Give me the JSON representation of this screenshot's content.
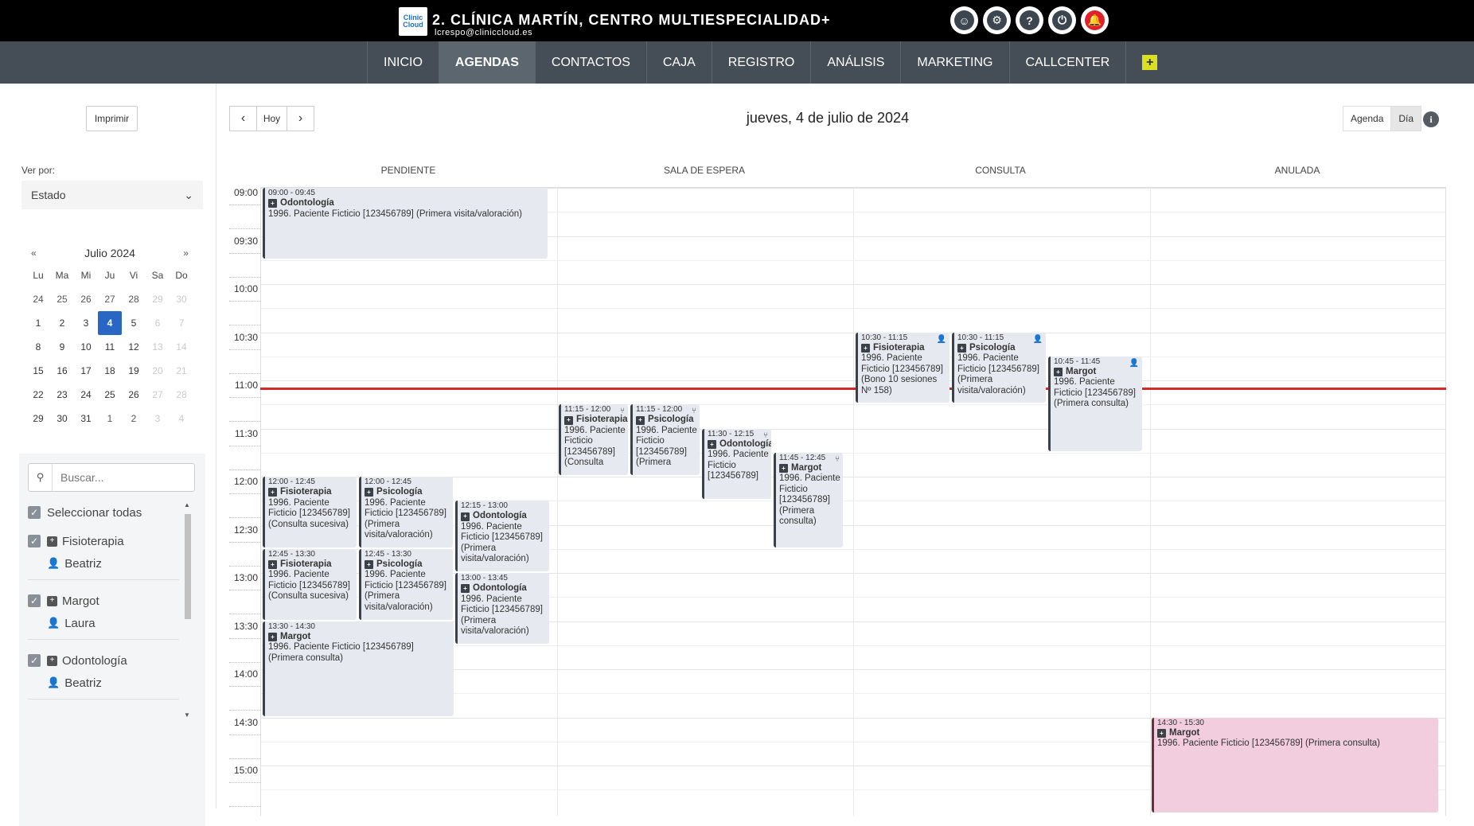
{
  "header": {
    "logo_text": "Clinic Cloud",
    "clinic_name": "2. CLÍNICA MARTÍN, CENTRO MULTIESPECIALIDAD+",
    "user_email": "lcrespo@cliniccloud.es",
    "icons": [
      "support-icon",
      "gear-icon",
      "help-icon",
      "power-icon",
      "bell-alert-icon"
    ]
  },
  "nav": {
    "items": [
      "INICIO",
      "AGENDAS",
      "CONTACTOS",
      "CAJA",
      "REGISTRO",
      "ANÁLISIS",
      "MARKETING",
      "CALLCENTER"
    ],
    "active": "AGENDAS",
    "add_label": "+"
  },
  "sidebar": {
    "print_label": "Imprimir",
    "ver_por_label": "Ver por:",
    "ver_por_value": "Estado",
    "calendar": {
      "prev": "«",
      "next": "»",
      "month": "Julio 2024",
      "weekdays": [
        "Lu",
        "Ma",
        "Mi",
        "Ju",
        "Vi",
        "Sa",
        "Do"
      ],
      "weeks": [
        [
          "24",
          "25",
          "26",
          "27",
          "28",
          "29",
          "30"
        ],
        [
          "1",
          "2",
          "3",
          "4",
          "5",
          "6",
          "7"
        ],
        [
          "8",
          "9",
          "10",
          "11",
          "12",
          "13",
          "14"
        ],
        [
          "15",
          "16",
          "17",
          "18",
          "19",
          "20",
          "21"
        ],
        [
          "22",
          "23",
          "24",
          "25",
          "26",
          "27",
          "28"
        ],
        [
          "29",
          "30",
          "31",
          "1",
          "2",
          "3",
          "4"
        ]
      ],
      "selected": "4"
    },
    "search_placeholder": "Buscar...",
    "select_all": "Seleccionar todas",
    "groups": [
      {
        "service": "Fisioterapia",
        "person": "Beatriz"
      },
      {
        "service": "Margot",
        "person": "Laura"
      },
      {
        "service": "Odontología",
        "person": "Beatriz"
      }
    ]
  },
  "toolbar": {
    "prev": "‹",
    "today": "Hoy",
    "next": "›",
    "date_title": "jueves, 4 de julio de 2024",
    "view_agenda": "Agenda",
    "view_day": "Día",
    "info": "i"
  },
  "columns": [
    "PENDIENTE",
    "SALA DE ESPERA",
    "CONSULTA",
    "ANULADA"
  ],
  "times": [
    "09:00",
    "09:30",
    "10:00",
    "10:30",
    "11:00",
    "11:30",
    "12:00",
    "12:30",
    "13:00",
    "13:30",
    "14:00",
    "14:30",
    "15:00"
  ],
  "events": [
    {
      "time": "09:00 - 09:45",
      "service": "Odontología",
      "patient": "1996. Paciente Ficticio [123456789] (Primera visita/valoración)",
      "status": "PENDIENTE"
    },
    {
      "time": "12:00 - 12:45",
      "service": "Fisioterapia",
      "patient": "1996. Paciente Ficticio [123456789] (Consulta sucesiva)",
      "status": "PENDIENTE"
    },
    {
      "time": "12:00 - 12:45",
      "service": "Psicología",
      "patient": "1996. Paciente Ficticio [123456789] (Primera visita/valoración)",
      "status": "PENDIENTE"
    },
    {
      "time": "12:15 - 13:00",
      "service": "Odontología",
      "patient": "1996. Paciente Ficticio [123456789] (Primera visita/valoración)",
      "status": "PENDIENTE"
    },
    {
      "time": "12:45 - 13:30",
      "service": "Fisioterapia",
      "patient": "1996. Paciente Ficticio [123456789] (Consulta sucesiva)",
      "status": "PENDIENTE"
    },
    {
      "time": "12:45 - 13:30",
      "service": "Psicología",
      "patient": "1996. Paciente Ficticio [123456789] (Primera visita/valoración)",
      "status": "PENDIENTE"
    },
    {
      "time": "13:00 - 13:45",
      "service": "Odontología",
      "patient": "1996. Paciente Ficticio [123456789] (Primera visita/valoración)",
      "status": "PENDIENTE"
    },
    {
      "time": "13:30 - 14:30",
      "service": "Margot",
      "patient": "1996. Paciente Ficticio [123456789] (Primera consulta)",
      "status": "PENDIENTE"
    },
    {
      "time": "11:15 - 12:00",
      "service": "Fisioterapia",
      "patient": "1996. Paciente Ficticio [123456789] (Consulta",
      "status": "SALA DE ESPERA"
    },
    {
      "time": "11:15 - 12:00",
      "service": "Psicología",
      "patient": "1996. Paciente Ficticio [123456789] (Primera",
      "status": "SALA DE ESPERA"
    },
    {
      "time": "11:30 - 12:15",
      "service": "Odontología",
      "patient": "1996. Paciente Ficticio [123456789]",
      "status": "SALA DE ESPERA"
    },
    {
      "time": "11:45 - 12:45",
      "service": "Margot",
      "patient": "1996. Paciente Ficticio [123456789] (Primera consulta)",
      "status": "SALA DE ESPERA"
    },
    {
      "time": "10:30 - 11:15",
      "service": "Fisioterapia",
      "patient": "1996. Paciente Ficticio [123456789] (Bono 10 sesiones Nº 158)",
      "status": "CONSULTA"
    },
    {
      "time": "10:30 - 11:15",
      "service": "Psicología",
      "patient": "1996. Paciente Ficticio [123456789] (Primera visita/valoración)",
      "status": "CONSULTA"
    },
    {
      "time": "10:45 - 11:45",
      "service": "Margot",
      "patient": "1996. Paciente Ficticio [123456789] (Primera consulta)",
      "status": "CONSULTA"
    },
    {
      "time": "14:30 - 15:30",
      "service": "Margot",
      "patient": "1996. Paciente Ficticio [123456789] (Primera consulta)",
      "status": "ANULADA"
    }
  ],
  "colors": {
    "topbar": "#000000",
    "navbar": "#454e56",
    "selected_day": "#2a67c5",
    "now_line": "#d62828",
    "event_bg": "#e6e9f0",
    "cancelled_bg": "#f1cdde",
    "add_button": "#d9e021"
  }
}
